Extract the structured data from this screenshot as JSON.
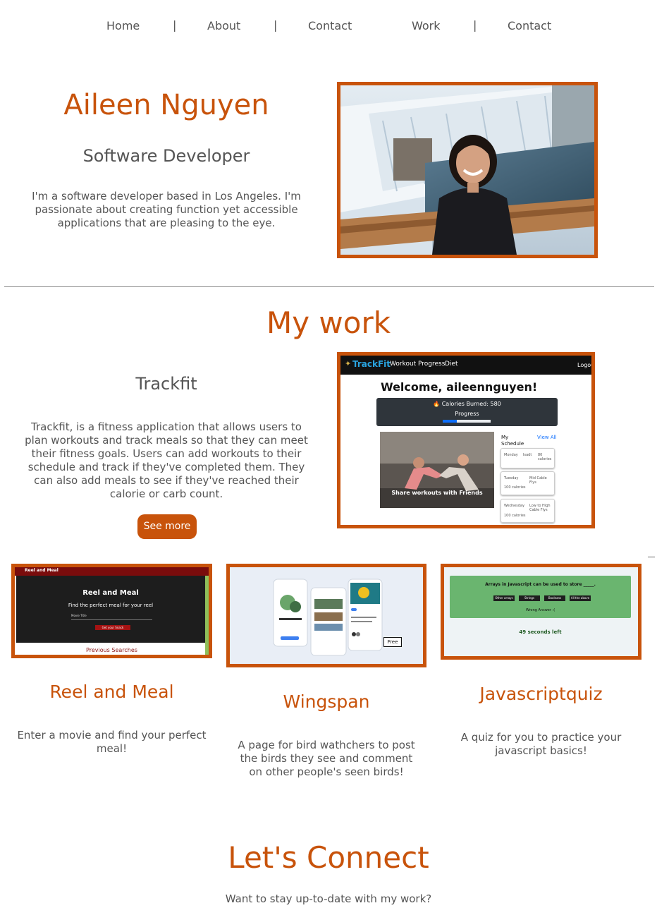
{
  "nav": {
    "items": [
      "Home",
      "About",
      "Contact",
      "Work",
      "Contact"
    ],
    "separator": "|"
  },
  "hero": {
    "name": "Aileen Nguyen",
    "role": "Software Developer",
    "bio": "I'm a software developer based in Los Angeles. I'm passionate about creating function yet accessible applications that are pleasing to the eye."
  },
  "work": {
    "heading": "My work",
    "featured": {
      "title": "Trackfit",
      "description": "Trackfit, is a fitness application that allows users to plan workouts and track meals so that they can meet their fitness goals. Users can add workouts to their schedule and track if they've completed them. They can also add meals to see if they've reached their calorie or carb count.",
      "button": "See more",
      "screenshot": {
        "brand": "TrackFit",
        "nav": [
          "Workout",
          "Progress",
          "Diet"
        ],
        "logout": "Logou",
        "welcome": "Welcome, aileennguyen!",
        "calories": "🔥 Calories Burned: 580",
        "progress_label": "Progress",
        "progress_fraction": 0.3,
        "image_caption": "Share workouts with Friends",
        "schedule_title": "My Schedule",
        "view_all": "View All",
        "schedule": [
          {
            "day": "Monday",
            "exercise": "Isadt",
            "calories": "80 calories"
          },
          {
            "day": "Tuesday",
            "exercise": "Mid Cable Flys",
            "calories": "100 calories"
          },
          {
            "day": "Wednesday",
            "exercise": "Low to High Cable Flys",
            "calories": "100 calories"
          }
        ]
      }
    },
    "projects": [
      {
        "title": "Reel and Meal",
        "description": "Enter a movie and find your perfect meal!",
        "shot": {
          "bar_title": "Reel and Meal",
          "main_title": "Reel and Meal",
          "tagline": "Find the perfect meal for your reel",
          "input_hint": "Movie Title",
          "button": "Get your Snack",
          "footer": "Previous Searches"
        }
      },
      {
        "title": "Wingspan",
        "description": "A page for bird wathchers to post the birds they see and comment on other people's seen birds!",
        "shot": {
          "badge": "Free"
        }
      },
      {
        "title": "Javascriptquiz",
        "description": "A quiz for you to practice your javascript basics!",
        "shot": {
          "question": "Arrays in Javascript can be used to store _____.",
          "options": [
            "Other arrays",
            "Strings",
            "Booleans",
            "All the above"
          ],
          "feedback": "Wrong Answer :(",
          "timer": "49 seconds left"
        }
      }
    ]
  },
  "connect": {
    "heading": "Let's Connect",
    "subtext": "Want to stay up-to-date with my work?"
  },
  "colors": {
    "accent": "#c8530b",
    "text": "#555555"
  }
}
